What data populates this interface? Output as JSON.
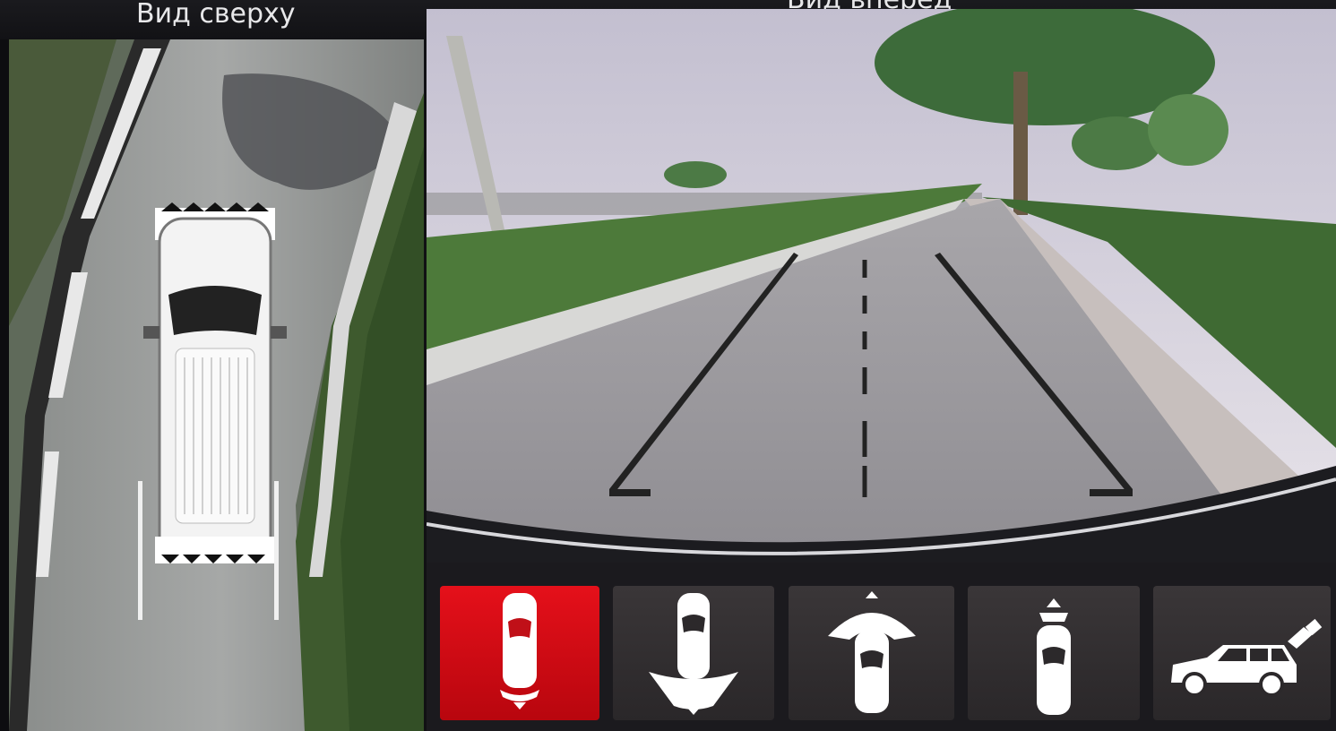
{
  "header": {
    "left_title": "Вид сверху",
    "right_title": "Вид вперёд"
  },
  "views": {
    "top": {
      "icon": "top-view-car"
    },
    "rear": {
      "icon": "front-camera-road"
    }
  },
  "modes": [
    {
      "icon": "top-rear-view-icon",
      "active": true
    },
    {
      "icon": "wide-rear-view-icon",
      "active": false
    },
    {
      "icon": "wide-front-view-icon",
      "active": false
    },
    {
      "icon": "front-view-icon",
      "active": false
    },
    {
      "icon": "side-camera-view-icon",
      "active": false
    }
  ],
  "colors": {
    "active_mode": "#d90a14",
    "inactive_mode": "#333033",
    "guide_line": "#222222"
  }
}
